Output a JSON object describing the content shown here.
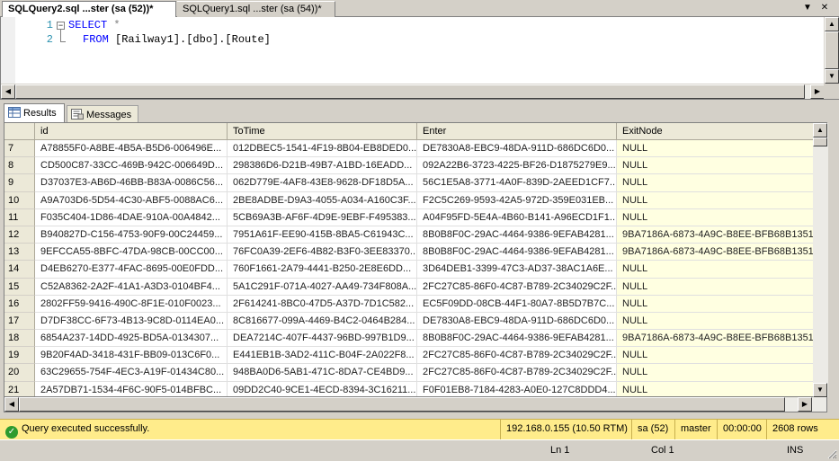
{
  "document_tabs": [
    {
      "label": "SQLQuery2.sql ...ster (sa (52))*",
      "active": true
    },
    {
      "label": "SQLQuery1.sql ...ster (sa (54))*",
      "active": false
    }
  ],
  "tabstrip_buttons": {
    "dropdown": "▼",
    "close": "✕"
  },
  "editor": {
    "line_numbers": [
      "1",
      "2"
    ],
    "lines": [
      {
        "keyword": "SELECT",
        "rest": "*"
      },
      {
        "keyword": "FROM",
        "rest": "[Railway1].[dbo].[Route]"
      }
    ],
    "outline_symbol": "−"
  },
  "results_tabs": [
    {
      "label": "Results",
      "icon": "grid-icon",
      "active": true
    },
    {
      "label": "Messages",
      "icon": "messages-icon",
      "active": false
    }
  ],
  "grid": {
    "columns": [
      "",
      "id",
      "ToTime",
      "Enter",
      "ExitNode"
    ],
    "rows": [
      {
        "n": "7",
        "id": "A78855F0-A8BE-4B5A-B5D6-006496E...",
        "to": "012DBEC5-1541-4F19-8B04-EB8DED0...",
        "en": "DE7830A8-EBC9-48DA-911D-686DC6D0...",
        "ex": "NULL"
      },
      {
        "n": "8",
        "id": "CD500C87-33CC-469B-942C-006649D...",
        "to": "298386D6-D21B-49B7-A1BD-16EADD...",
        "en": "092A22B6-3723-4225-BF26-D1875279E9...",
        "ex": "NULL"
      },
      {
        "n": "9",
        "id": "D37037E3-AB6D-46BB-B83A-0086C56...",
        "to": "062D779E-4AF8-43E8-9628-DF18D5A...",
        "en": "56C1E5A8-3771-4A0F-839D-2AEED1CF7...",
        "ex": "NULL"
      },
      {
        "n": "10",
        "id": "A9A703D6-5D54-4C30-ABF5-0088AC6...",
        "to": "2BE8ADBE-D9A3-4055-A034-A160C3F...",
        "en": "F2C5C269-9593-42A5-972D-359E031EB...",
        "ex": "NULL"
      },
      {
        "n": "11",
        "id": "F035C404-1D86-4DAE-910A-00A4842...",
        "to": "5CB69A3B-AF6F-4D9E-9EBF-F495383...",
        "en": "A04F95FD-5E4A-4B60-B141-A96ECD1F1...",
        "ex": "NULL"
      },
      {
        "n": "12",
        "id": "B940827D-C156-4753-90F9-00C24459...",
        "to": "7951A61F-EE90-415B-8BA5-C61943C...",
        "en": "8B0B8F0C-29AC-4464-9386-9EFAB4281...",
        "ex": "9BA7186A-6873-4A9C-B8EE-BFB68B1351B5"
      },
      {
        "n": "13",
        "id": "9EFCCA55-8BFC-47DA-98CB-00CC00...",
        "to": "76FC0A39-2EF6-4B82-B3F0-3EE83370...",
        "en": "8B0B8F0C-29AC-4464-9386-9EFAB4281...",
        "ex": "9BA7186A-6873-4A9C-B8EE-BFB68B1351B5"
      },
      {
        "n": "14",
        "id": "D4EB6270-E377-4FAC-8695-00E0FDD...",
        "to": "760F1661-2A79-4441-B250-2E8E6DD...",
        "en": "3D64DEB1-3399-47C3-AD37-38AC1A6E...",
        "ex": "NULL"
      },
      {
        "n": "15",
        "id": "C52A8362-2A2F-41A1-A3D3-0104BF4...",
        "to": "5A1C291F-071A-4027-AA49-734F808A...",
        "en": "2FC27C85-86F0-4C87-B789-2C34029C2F...",
        "ex": "NULL"
      },
      {
        "n": "16",
        "id": "2802FF59-9416-490C-8F1E-010F0023...",
        "to": "2F614241-8BC0-47D5-A37D-7D1C582...",
        "en": "EC5F09DD-08CB-44F1-80A7-8B5D7B7C...",
        "ex": "NULL"
      },
      {
        "n": "17",
        "id": "D7DF38CC-6F73-4B13-9C8D-0114EA0...",
        "to": "8C816677-099A-4469-B4C2-0464B284...",
        "en": "DE7830A8-EBC9-48DA-911D-686DC6D0...",
        "ex": "NULL"
      },
      {
        "n": "18",
        "id": "6854A237-14DD-4925-BD5A-0134307...",
        "to": "DEA7214C-407F-4437-96BD-997B1D9...",
        "en": "8B0B8F0C-29AC-4464-9386-9EFAB4281...",
        "ex": "9BA7186A-6873-4A9C-B8EE-BFB68B1351B5"
      },
      {
        "n": "19",
        "id": "9B20F4AD-3418-431F-BB09-013C6F0...",
        "to": "E441EB1B-3AD2-411C-B04F-2A022F8...",
        "en": "2FC27C85-86F0-4C87-B789-2C34029C2F...",
        "ex": "NULL"
      },
      {
        "n": "20",
        "id": "63C29655-754F-4EC3-A19F-01434C80...",
        "to": "948BA0D6-5AB1-471C-8DA7-CE4BD9...",
        "en": "2FC27C85-86F0-4C87-B789-2C34029C2F...",
        "ex": "NULL"
      },
      {
        "n": "21",
        "id": "2A57DB71-1534-4F6C-90F5-014BFBC...",
        "to": "09DD2C40-9CE1-4ECD-8394-3C16211...",
        "en": "F0F01EB8-7184-4283-A0E0-127C8DDD4...",
        "ex": "NULL"
      }
    ]
  },
  "query_status": {
    "message": "Query executed successfully.",
    "server": "192.168.0.155 (10.50 RTM)",
    "user": "sa (52)",
    "database": "master",
    "elapsed": "00:00:00",
    "rows": "2608 rows"
  },
  "app_status": {
    "line": "Ln 1",
    "col": "Col 1",
    "mode": "INS"
  },
  "colors": {
    "status_bar": "#ffec8b",
    "null_cell": "#ffffe1",
    "keyword": "#0000ff",
    "line_numbers": "#2b91af"
  }
}
